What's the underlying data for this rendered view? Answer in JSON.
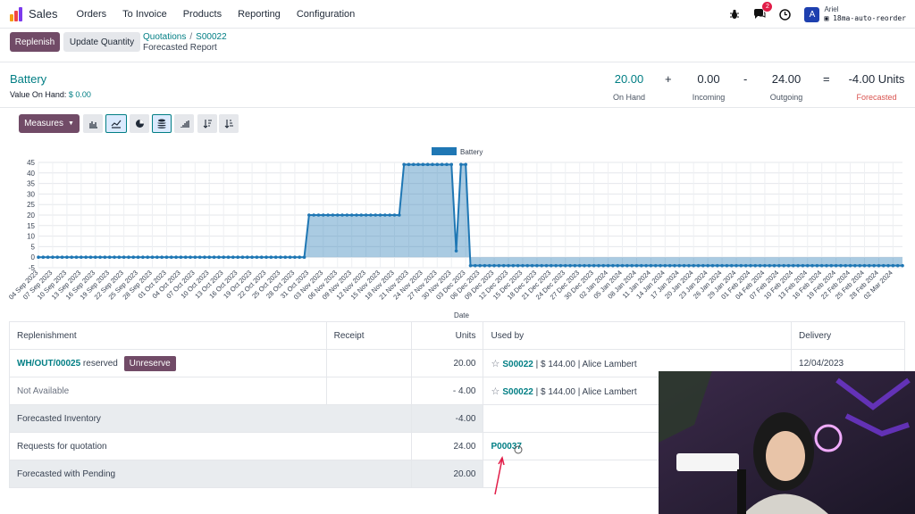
{
  "nav": {
    "app_name": "Sales",
    "menu": [
      "Orders",
      "To Invoice",
      "Products",
      "Reporting",
      "Configuration"
    ],
    "message_count": "2",
    "avatar_letter": "A",
    "user_name": "Ariel",
    "database": "18ma-auto-reorder"
  },
  "control": {
    "replenish_label": "Replenish",
    "update_qty_label": "Update Quantity",
    "breadcrumb": [
      "Quotations",
      "S00022"
    ],
    "current_page": "Forecasted Report"
  },
  "product": {
    "name": "Battery",
    "value_label": "Value On Hand:",
    "value_amount": "$ 0.00"
  },
  "kpis": {
    "on_hand": {
      "value": "20.00",
      "label": "On Hand"
    },
    "op1": "+",
    "incoming": {
      "value": "0.00",
      "label": "Incoming"
    },
    "op2": "-",
    "outgoing": {
      "value": "24.00",
      "label": "Outgoing"
    },
    "op3": "=",
    "forecasted": {
      "value": "-4.00 Units",
      "label": "Forecasted"
    }
  },
  "toolbar": {
    "measures_label": "Measures",
    "icons": [
      "bar-chart-icon",
      "line-chart-icon",
      "pie-chart-icon",
      "stacked-icon",
      "cumulative-icon",
      "sort-desc-icon",
      "sort-asc-icon"
    ]
  },
  "colors": {
    "brand": "#714B67",
    "teal": "#017e84",
    "series": "#1f77b4",
    "forecast_red": "#d9534f"
  },
  "chart_data": {
    "type": "area",
    "legend": [
      "Battery"
    ],
    "legend_position": "top-center",
    "xlabel": "Date",
    "ylabel": "",
    "ylim": [
      -5,
      45
    ],
    "yticks": [
      -5,
      0,
      5,
      10,
      15,
      20,
      25,
      30,
      35,
      40,
      45
    ],
    "grid": true,
    "x_tick_labels": [
      "04 Sep 2023",
      "07 Sep 2023",
      "10 Sep 2023",
      "13 Sep 2023",
      "16 Sep 2023",
      "19 Sep 2023",
      "22 Sep 2023",
      "25 Sep 2023",
      "28 Sep 2023",
      "01 Oct 2023",
      "04 Oct 2023",
      "07 Oct 2023",
      "10 Oct 2023",
      "13 Oct 2023",
      "16 Oct 2023",
      "19 Oct 2023",
      "22 Oct 2023",
      "25 Oct 2023",
      "28 Oct 2023",
      "31 Oct 2023",
      "03 Nov 2023",
      "06 Nov 2023",
      "09 Nov 2023",
      "12 Nov 2023",
      "15 Nov 2023",
      "18 Nov 2023",
      "21 Nov 2023",
      "24 Nov 2023",
      "27 Nov 2023",
      "30 Nov 2023",
      "03 Dec 2023",
      "06 Dec 2023",
      "09 Dec 2023",
      "12 Dec 2023",
      "15 Dec 2023",
      "18 Dec 2023",
      "21 Dec 2023",
      "24 Dec 2023",
      "27 Dec 2023",
      "30 Dec 2023",
      "02 Jan 2024",
      "05 Jan 2024",
      "08 Jan 2024",
      "11 Jan 2024",
      "14 Jan 2024",
      "17 Jan 2024",
      "20 Jan 2024",
      "23 Jan 2024",
      "26 Jan 2024",
      "29 Jan 2024",
      "01 Feb 2024",
      "04 Feb 2024",
      "07 Feb 2024",
      "10 Feb 2024",
      "13 Feb 2024",
      "16 Feb 2024",
      "19 Feb 2024",
      "22 Feb 2024",
      "25 Feb 2024",
      "28 Feb 2024",
      "02 Mar 2024"
    ],
    "series": [
      {
        "name": "Battery",
        "points": [
          {
            "x": "2023-09-04",
            "y": 0
          },
          {
            "x": "2023-10-30",
            "y": 0
          },
          {
            "x": "2023-10-31",
            "y": 20
          },
          {
            "x": "2023-11-19",
            "y": 20
          },
          {
            "x": "2023-11-20",
            "y": 44
          },
          {
            "x": "2023-11-30",
            "y": 44
          },
          {
            "x": "2023-12-01",
            "y": 3
          },
          {
            "x": "2023-12-02",
            "y": 44
          },
          {
            "x": "2023-12-03",
            "y": 44
          },
          {
            "x": "2023-12-04",
            "y": -4
          },
          {
            "x": "2024-03-04",
            "y": -4
          }
        ]
      }
    ]
  },
  "table": {
    "headers": [
      "Replenishment",
      "Receipt",
      "Units",
      "Used by",
      "Delivery"
    ],
    "rows": [
      {
        "repl_link": "WH/OUT/00025",
        "repl_text": "reserved",
        "action": "Unreserve",
        "receipt": "",
        "units": "20.00",
        "used_ref": "S00022",
        "used_rest": "| $ 144.00 | Alice Lambert",
        "delivery": "12/04/2023"
      },
      {
        "repl_text": "Not Available",
        "receipt": "",
        "units": "- 4.00",
        "used_ref": "S00022",
        "used_rest": "| $ 144.00 | Alice Lambert",
        "delivery": ""
      },
      {
        "label": "Forecasted Inventory",
        "units": "-4.00"
      },
      {
        "label": "Requests for quotation",
        "units": "24.00",
        "used_ref": "P00037"
      },
      {
        "label": "Forecasted with Pending",
        "units": "20.00"
      }
    ]
  }
}
